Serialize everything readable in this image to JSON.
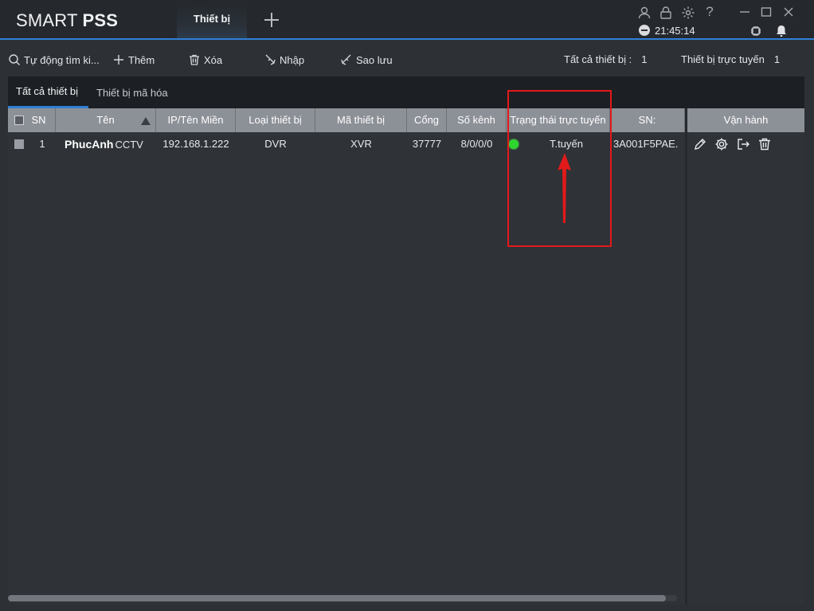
{
  "app": {
    "logo_light": "SMART ",
    "logo_bold": "PSS",
    "active_nav_tab": "Thiết bị",
    "clock": "21:45:14"
  },
  "icons": {
    "user": "user-icon",
    "lock": "lock-icon",
    "settings": "gear-icon",
    "help": "help-icon",
    "minimize": "minimize-icon",
    "maximize": "maximize-icon",
    "close": "close-icon",
    "cpu": "cpu-icon",
    "bell": "bell-icon"
  },
  "toolbar": {
    "auto_search": "Tự động tìm ki...",
    "add": "Thêm",
    "delete": "Xóa",
    "import": "Nhập",
    "backup": "Sao lưu",
    "all_devices_label": "Tất cả thiết bị :",
    "all_devices_count": "1",
    "online_devices_label": "Thiết bị trực tuyến",
    "online_devices_count": "1"
  },
  "subtabs": {
    "all": "Tất cả thiết bị",
    "encoded": "Thiết bị mã hóa"
  },
  "table": {
    "columns": {
      "sn": "SN",
      "name": "Tên",
      "ip": "IP/Tên Miền",
      "type": "Loại thiết bị",
      "model": "Mã thiết bị",
      "port": "Cổng",
      "channels": "Số kênh",
      "status": "Trạng thái trực tuyến",
      "serial": "SN:",
      "ops": "Vận hành"
    },
    "rows": [
      {
        "sn": "1",
        "name_bold": "PhucAnh",
        "name_rest": "CCTV",
        "ip": "192.168.1.222",
        "type": "DVR",
        "model": "XVR",
        "port": "37777",
        "channels": "8/0/0/0",
        "status": "T.tuyến",
        "serial": "3A001F5PAE."
      }
    ]
  },
  "colors": {
    "accent": "#2f7fd6",
    "online": "#2ed52e",
    "annotation": "#e21a1a"
  }
}
